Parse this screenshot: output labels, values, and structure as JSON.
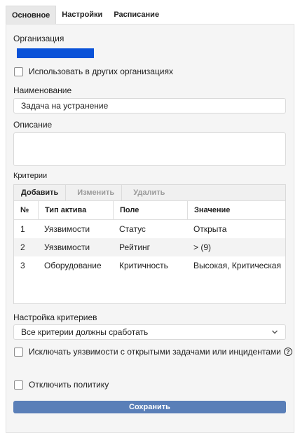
{
  "tabs": [
    {
      "label": "Основное",
      "active": true
    },
    {
      "label": "Настройки",
      "active": false
    },
    {
      "label": "Расписание",
      "active": false
    }
  ],
  "form": {
    "organization_label": "Организация",
    "use_in_other_orgs_label": "Использовать в других организациях",
    "name_label": "Наименование",
    "name_value": "Задача на устранение",
    "description_label": "Описание",
    "description_value": "",
    "criteria_label": "Критерии",
    "criteria_settings_label": "Настройка критериев",
    "criteria_settings_value": "Все критерии должны сработать",
    "exclude_label": "Исключать уязвимости с открытыми задачами или инцидентами",
    "disable_policy_label": "Отключить политику",
    "save_label": "Сохранить"
  },
  "grid": {
    "toolbar": {
      "add": "Добавить",
      "edit": "Изменить",
      "delete": "Удалить"
    },
    "columns": [
      "№",
      "Тип актива",
      "Поле",
      "Значение"
    ],
    "rows": [
      {
        "num": "1",
        "type": "Уязвимости",
        "field": "Статус",
        "value": "Открыта"
      },
      {
        "num": "2",
        "type": "Уязвимости",
        "field": "Рейтинг",
        "value": "> (9)"
      },
      {
        "num": "3",
        "type": "Оборудование",
        "field": "Критичность",
        "value": "Высокая, Критическая"
      }
    ]
  },
  "colors": {
    "accent": "#5a7fb8",
    "redaction": "#0a52d8"
  },
  "icons": {
    "select": "chevron-down-icon",
    "help": "question-circle-icon"
  }
}
